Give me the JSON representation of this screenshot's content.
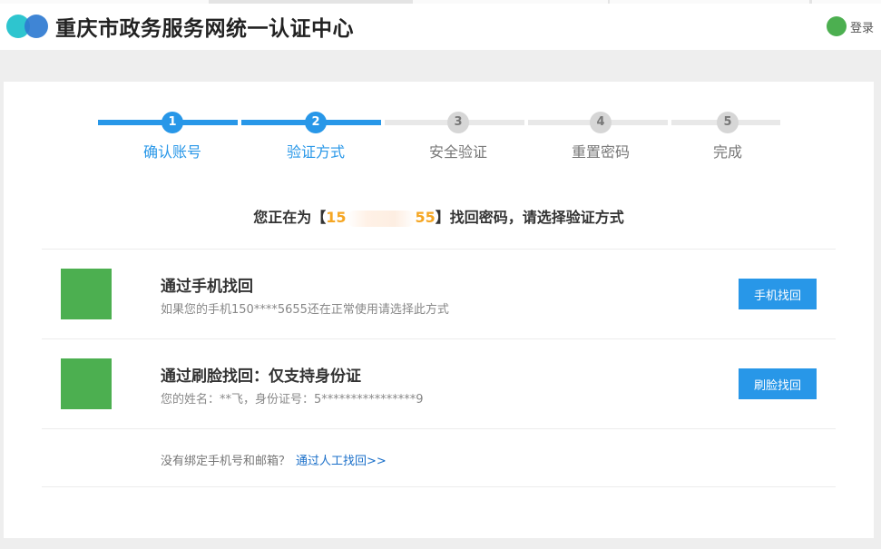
{
  "header": {
    "site_title": "重庆市政务服务网统一认证中心",
    "login_label": "登录"
  },
  "steps": [
    {
      "number": "1",
      "label": "确认账号",
      "state": "active"
    },
    {
      "number": "2",
      "label": "验证方式",
      "state": "active"
    },
    {
      "number": "3",
      "label": "安全验证",
      "state": "inactive"
    },
    {
      "number": "4",
      "label": "重置密码",
      "state": "inactive"
    },
    {
      "number": "5",
      "label": "完成",
      "state": "inactive"
    }
  ],
  "prompt": {
    "prefix": "您正在为【",
    "phone_start": "15",
    "phone_end": "55",
    "suffix": "】找回密码，请选择验证方式"
  },
  "options": [
    {
      "title": "通过手机找回",
      "desc": "如果您的手机150****5655还在正常使用请选择此方式",
      "button": "手机找回"
    },
    {
      "title": "通过刷脸找回：仅支持身份证",
      "desc": "您的姓名：**飞，身份证号：5****************9",
      "button": "刷脸找回"
    }
  ],
  "manual": {
    "text": "没有绑定手机号和邮箱？",
    "link": "通过人工找回>>"
  },
  "colors": {
    "accent": "#2897e8",
    "highlight": "#f5a623",
    "icon_green": "#4caf50",
    "link": "#1a6fc9"
  }
}
